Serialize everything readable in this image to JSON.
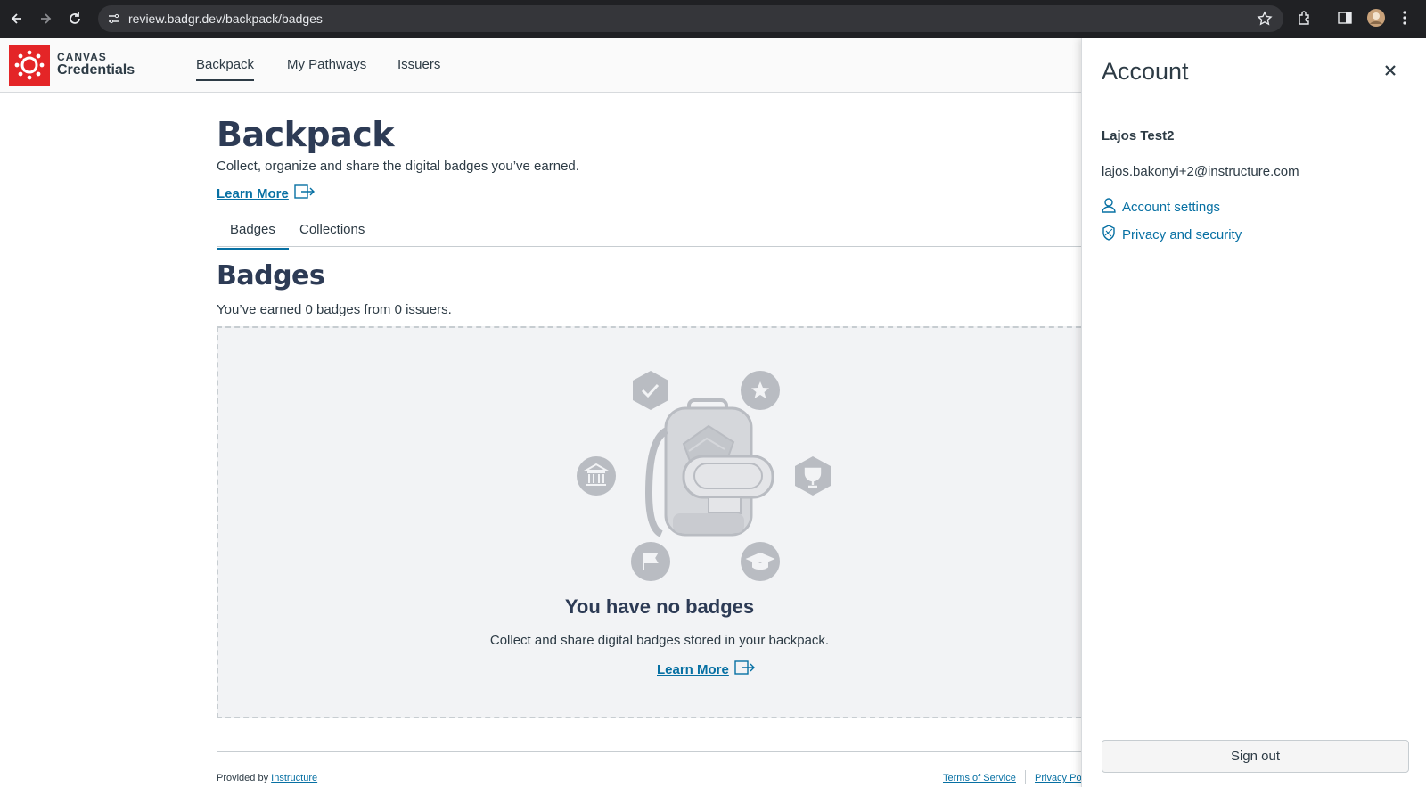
{
  "browser": {
    "url": "review.badgr.dev/backpack/badges"
  },
  "header": {
    "brand_top": "CANVAS",
    "brand_bottom": "Credentials",
    "nav": [
      "Backpack",
      "My Pathways",
      "Issuers"
    ],
    "active_nav": "Backpack"
  },
  "main": {
    "title": "Backpack",
    "subtitle": "Collect, organize and share the digital badges you’ve earned.",
    "learn_more": "Learn More",
    "tabs": [
      "Badges",
      "Collections"
    ],
    "active_tab": "Badges",
    "section_title": "Badges",
    "count_text": "You’ve earned 0 badges from 0 issuers.",
    "empty_title": "You have no badges",
    "empty_subtitle": "Collect and share digital badges stored in your backpack.",
    "empty_learn_more": "Learn More"
  },
  "footer": {
    "provided_by": "Provided by",
    "provider": "Instructure",
    "terms": "Terms of Service",
    "privacy": "Privacy Po"
  },
  "account_tray": {
    "title": "Account",
    "user_name": "Lajos Test2",
    "email": "lajos.bakonyi+2@instructure.com",
    "account_settings": "Account settings",
    "privacy_security": "Privacy and security",
    "sign_out": "Sign out"
  },
  "colors": {
    "brand_red": "#e42527",
    "link_blue": "#0770a3",
    "text_dark": "#2d3b45"
  }
}
